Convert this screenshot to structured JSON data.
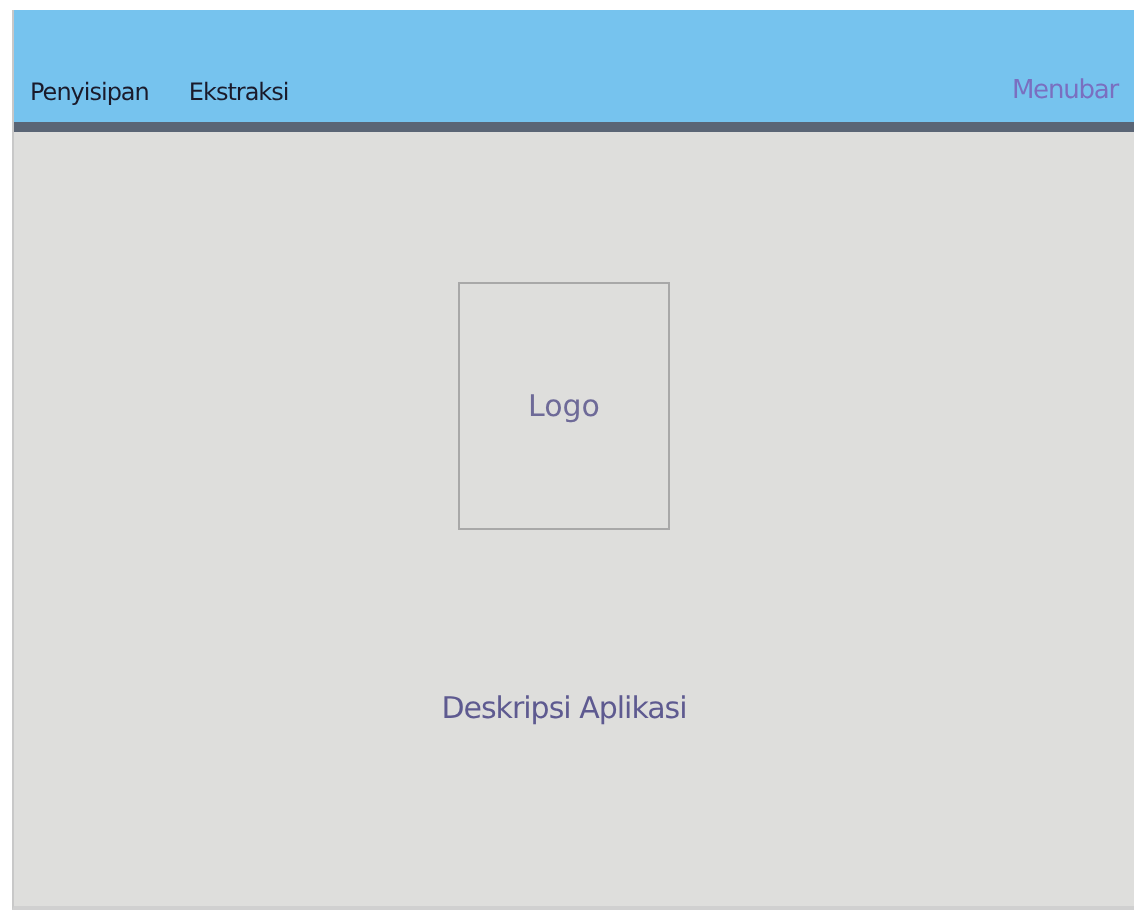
{
  "menubar": {
    "items": [
      {
        "label": "Penyisipan"
      },
      {
        "label": "Ekstraksi"
      }
    ],
    "caption": "Menubar"
  },
  "logo": {
    "label": "Logo"
  },
  "description": "Deskripsi Aplikasi"
}
